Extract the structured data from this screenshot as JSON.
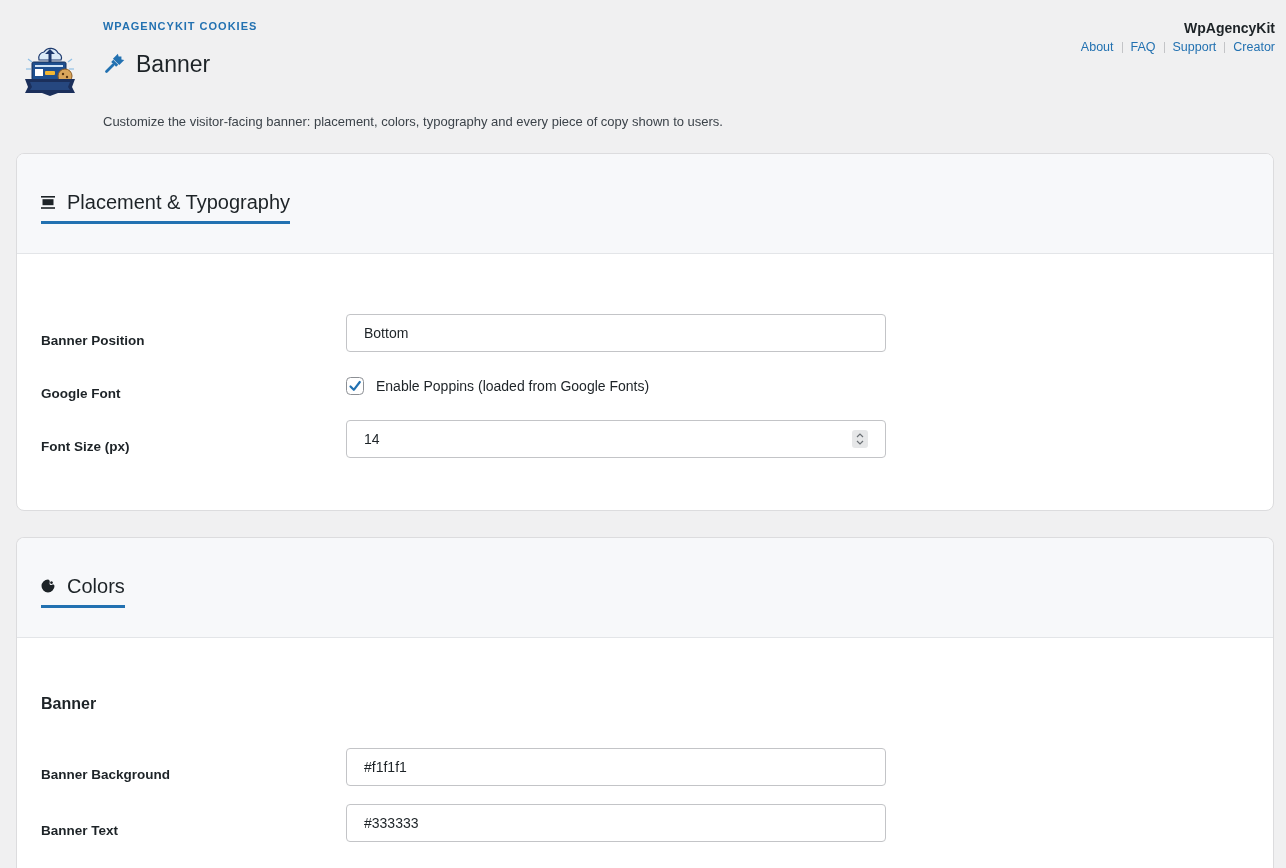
{
  "header": {
    "eyebrow": "WPAGENCYKIT COOKIES",
    "title": "Banner",
    "description": "Customize the visitor-facing banner: placement, colors, typography and every piece of copy shown to users.",
    "brand": "WpAgencyKit",
    "links": [
      "About",
      "FAQ",
      "Support",
      "Creator"
    ]
  },
  "sections": [
    {
      "title": "Placement & Typography",
      "fields": [
        {
          "kind": "select",
          "label": "Banner Position",
          "value": "Bottom"
        },
        {
          "kind": "checkbox",
          "label": "Google Font",
          "text": "Enable Poppins (loaded from Google Fonts)",
          "checked": true
        },
        {
          "kind": "number",
          "label": "Font Size (px)",
          "value": "14"
        }
      ]
    },
    {
      "title": "Colors",
      "fields": [
        {
          "kind": "heading",
          "label": "Banner"
        },
        {
          "kind": "text",
          "label": "Banner Background",
          "value": "#f1f1f1"
        },
        {
          "kind": "text",
          "label": "Banner Text",
          "value": "#333333"
        }
      ]
    }
  ]
}
